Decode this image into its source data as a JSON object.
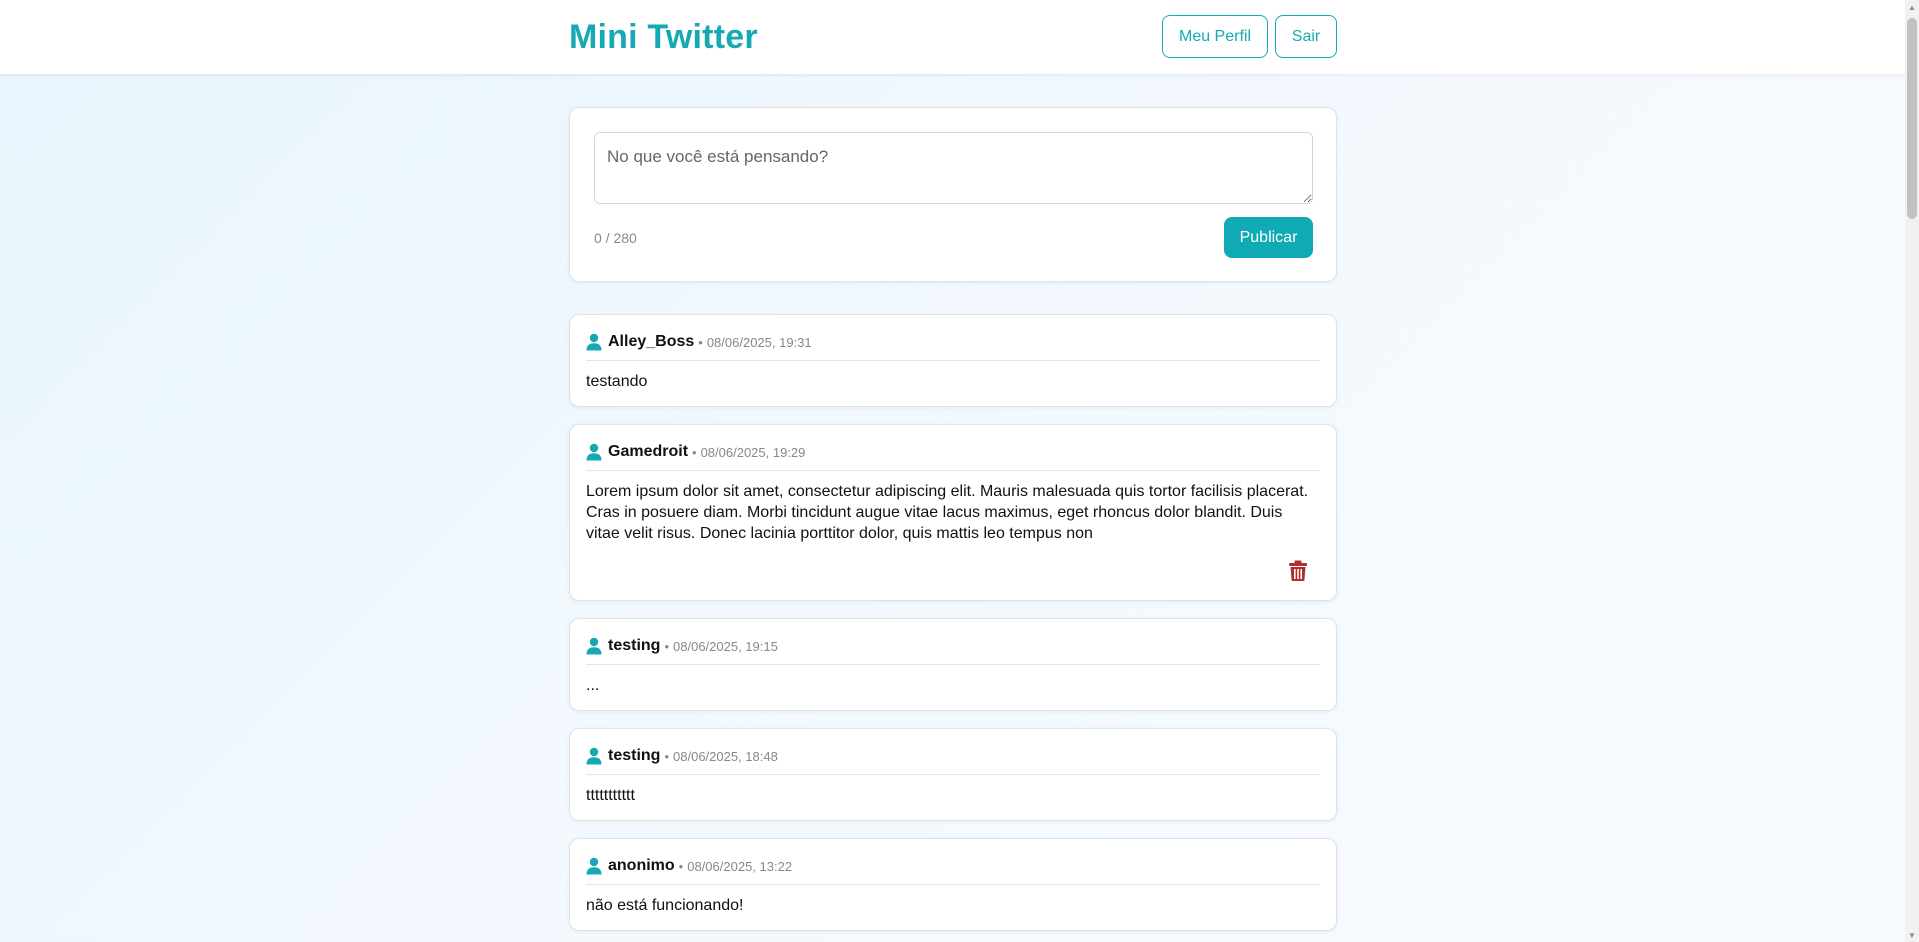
{
  "header": {
    "brand": "Mini Twitter",
    "profile_label": "Meu Perfil",
    "logout_label": "Sair"
  },
  "composer": {
    "placeholder": "No que você está pensando?",
    "value": "",
    "counter": "0 / 280",
    "publish_label": "Publicar"
  },
  "colors": {
    "accent": "#17a9b3",
    "delete": "#b22d2d"
  },
  "posts": [
    {
      "author": "Alley_Boss",
      "separator": "•",
      "timestamp": "08/06/2025, 19:31",
      "text": "testando",
      "deletable": false
    },
    {
      "author": "Gamedroit",
      "separator": "•",
      "timestamp": "08/06/2025, 19:29",
      "text": "Lorem ipsum dolor sit amet, consectetur adipiscing elit. Mauris malesuada quis tortor facilisis placerat. Cras in posuere diam. Morbi tincidunt augue vitae lacus maximus, eget rhoncus dolor blandit. Duis vitae velit risus. Donec lacinia porttitor dolor, quis mattis leo tempus non",
      "deletable": true,
      "delete_icon": "trash-icon"
    },
    {
      "author": "testing",
      "separator": "•",
      "timestamp": "08/06/2025, 19:15",
      "text": "...",
      "deletable": false
    },
    {
      "author": "testing",
      "separator": "•",
      "timestamp": "08/06/2025, 18:48",
      "text": "ttttttttttt",
      "deletable": false
    },
    {
      "author": "anonimo",
      "separator": "•",
      "timestamp": "08/06/2025, 13:22",
      "text": "não está funcionando!",
      "deletable": false
    }
  ],
  "icons": {
    "author": "user-icon",
    "delete": "trash-icon"
  }
}
